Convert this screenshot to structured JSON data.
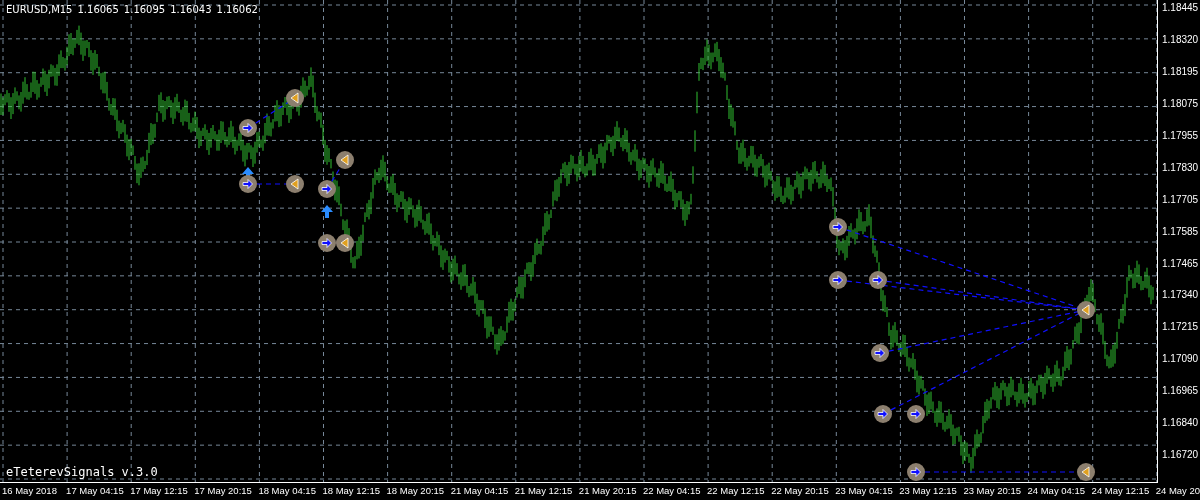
{
  "header": {
    "symbol": "EURUSD,M15",
    "quotes": [
      "1.16065",
      "1.16095",
      "1.16043",
      "1.16062"
    ]
  },
  "indicator_label": "eTeterevSignals v.3.0",
  "price_axis": [
    "1.18445",
    "1.18320",
    "1.18195",
    "1.18075",
    "1.17955",
    "1.17830",
    "1.17705",
    "1.17585",
    "1.17465",
    "1.17340",
    "1.17215",
    "1.17090",
    "1.16965",
    "1.16840",
    "1.16720"
  ],
  "time_axis": [
    "16 May 2018",
    "17 May 04:15",
    "17 May 12:15",
    "17 May 20:15",
    "18 May 04:15",
    "18 May 12:15",
    "18 May 20:15",
    "21 May 04:15",
    "21 May 12:15",
    "21 May 20:15",
    "22 May 04:15",
    "22 May 12:15",
    "22 May 20:15",
    "23 May 04:15",
    "23 May 12:15",
    "23 May 20:15",
    "24 May 04:15",
    "24 May 12:15",
    "24 May 20"
  ]
}
